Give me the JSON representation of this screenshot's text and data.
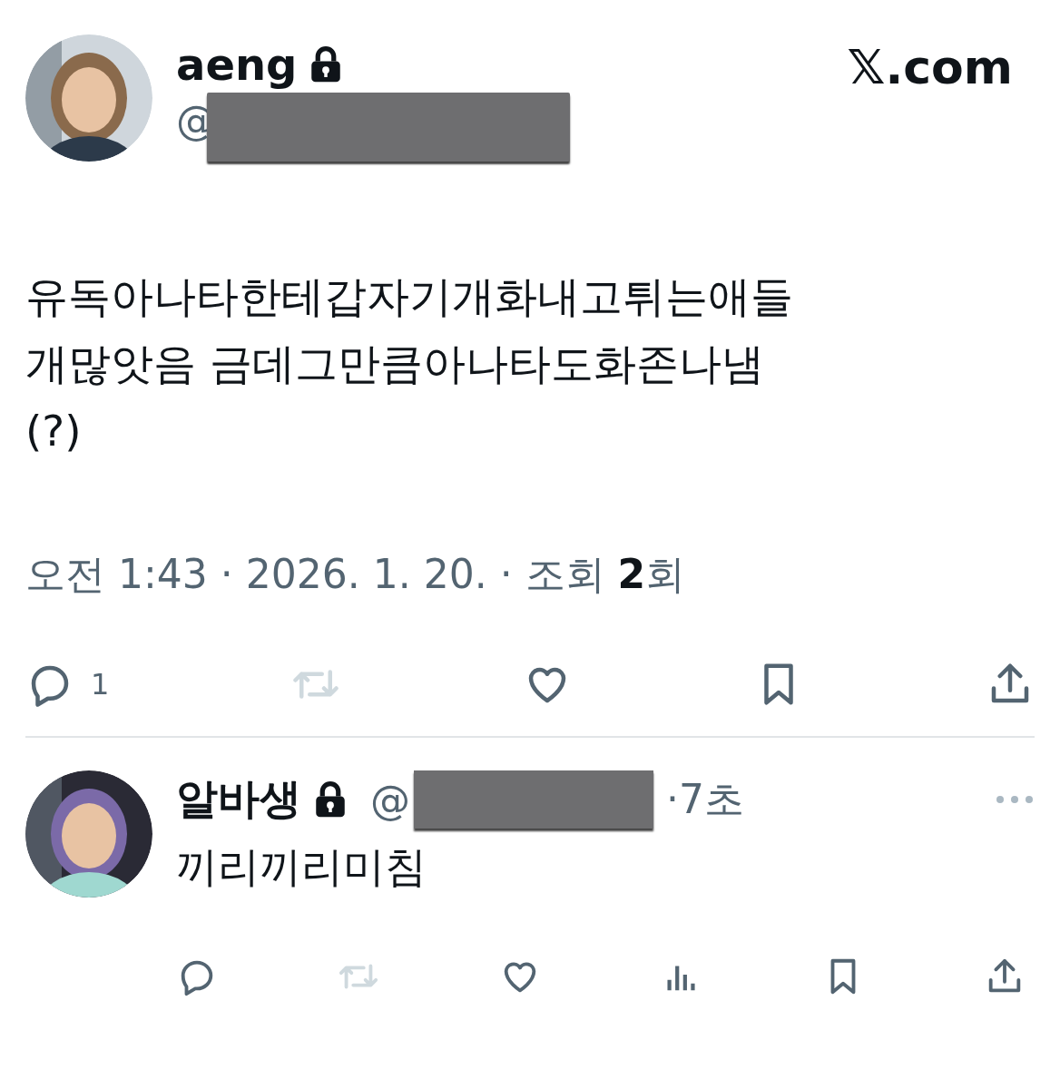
{
  "tweet": {
    "author": {
      "name": "aeng",
      "locked": true,
      "handle": "@"
    },
    "site": "𝕏.com",
    "text_lines": [
      "유독아나타한테갑자기개화내고튀는애들",
      "개많앗음 금데그만큼아나타도화존나냄",
      "(?)"
    ],
    "meta": "오전 1:43 · 2026. 1. 20. · 조회 **2**회",
    "actions": [
      {
        "kind": "reply",
        "count": "1",
        "disabled": false
      },
      {
        "kind": "retweet",
        "disabled": true
      },
      {
        "kind": "like",
        "disabled": false
      },
      {
        "kind": "bookmark",
        "disabled": false
      },
      {
        "kind": "share",
        "disabled": false
      }
    ]
  },
  "reply": {
    "author": {
      "name": "알바생",
      "locked": true,
      "handle": "@"
    },
    "time": "·7초",
    "text": "끼리끼리미침",
    "actions": [
      {
        "kind": "reply",
        "disabled": false
      },
      {
        "kind": "retweet",
        "disabled": true
      },
      {
        "kind": "like",
        "disabled": false
      },
      {
        "kind": "views",
        "disabled": false
      },
      {
        "kind": "bookmark",
        "disabled": false
      },
      {
        "kind": "share",
        "disabled": false
      }
    ]
  }
}
